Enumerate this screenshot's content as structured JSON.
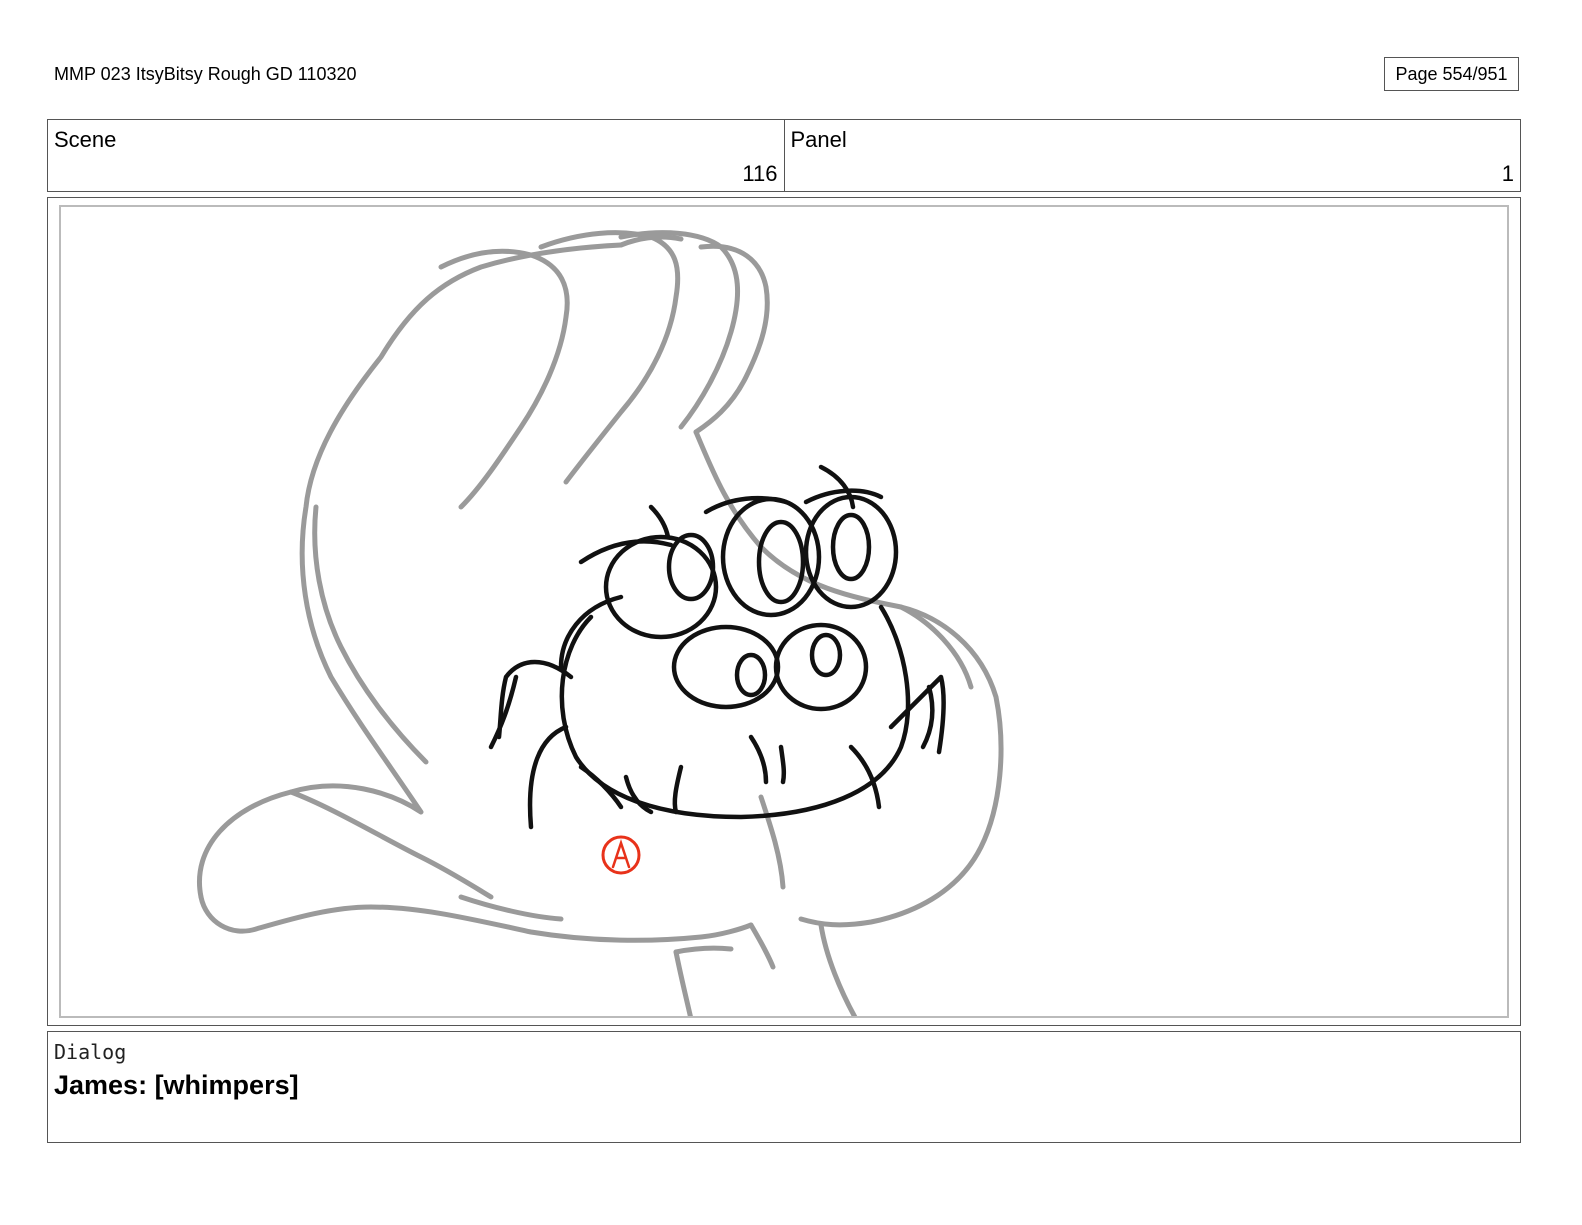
{
  "header": {
    "title": "MMP 023 ItsyBitsy Rough GD 110320",
    "page": "Page 554/951"
  },
  "scene": {
    "label": "Scene",
    "value": "116"
  },
  "panel": {
    "label": "Panel",
    "value": "1"
  },
  "artwork": {
    "subject": "spider character with multiple eyes sitting in a cupped hand",
    "marker": "A",
    "colors": {
      "rough_lines": "#9a9a9a",
      "ink_lines": "#111111",
      "marker": "#e8321a"
    }
  },
  "dialog": {
    "label": "Dialog",
    "text": "James: [whimpers]"
  }
}
